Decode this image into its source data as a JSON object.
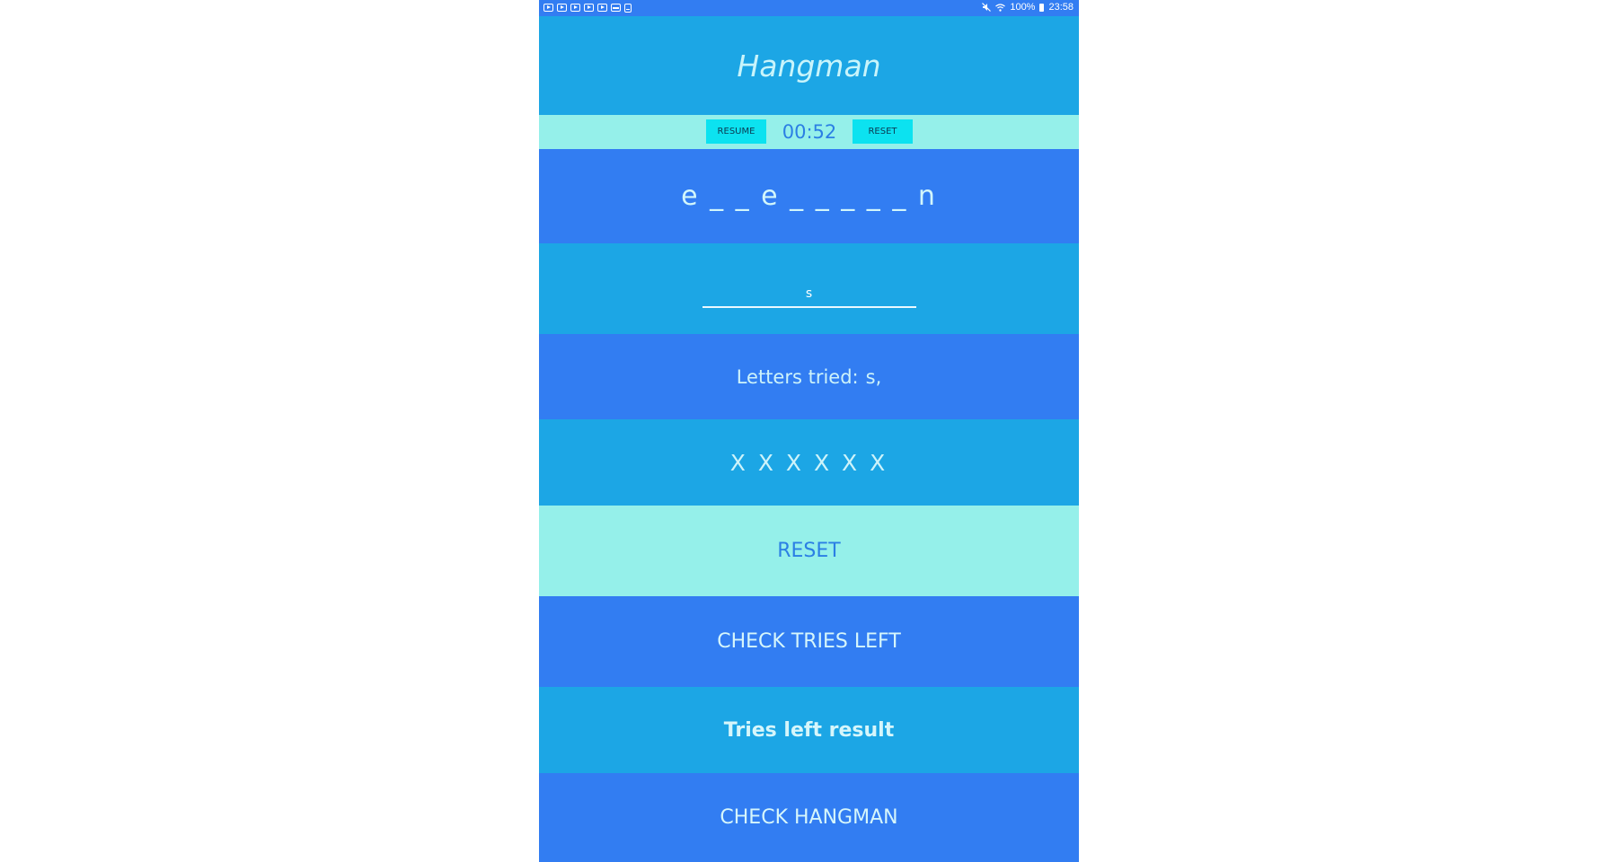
{
  "status_bar": {
    "left_icons": [
      "youtube-icon",
      "youtube-icon",
      "youtube-icon",
      "youtube-icon",
      "youtube-icon",
      "image-icon",
      "document-icon"
    ],
    "mute_icon": "mute-icon",
    "wifi_icon": "wifi-icon",
    "battery_percent": "100%",
    "time": "23:58"
  },
  "header": {
    "title": "Hangman"
  },
  "timer_bar": {
    "resume_label": "RESUME",
    "time": "00:52",
    "reset_label": "RESET"
  },
  "game": {
    "word_display": "e _ _ e _ _ _ _ _ n",
    "letter_input_value": "s",
    "letters_tried_label": "Letters tried:",
    "letters_tried_value": "s,",
    "wrong_marks": "X X X X X X"
  },
  "actions": {
    "reset_label": "RESET",
    "check_tries_label": "CHECK TRIES LEFT",
    "tries_left_result": "Tries left result",
    "check_hangman_label": "CHECK HANGMAN"
  },
  "colors": {
    "blue": "#327df2",
    "sky": "#1ca6e5",
    "mint": "#95f0ea",
    "cyan_button": "#0ce2f0",
    "text_light": "#d2f6fb",
    "text_blue": "#2b7fe4"
  }
}
